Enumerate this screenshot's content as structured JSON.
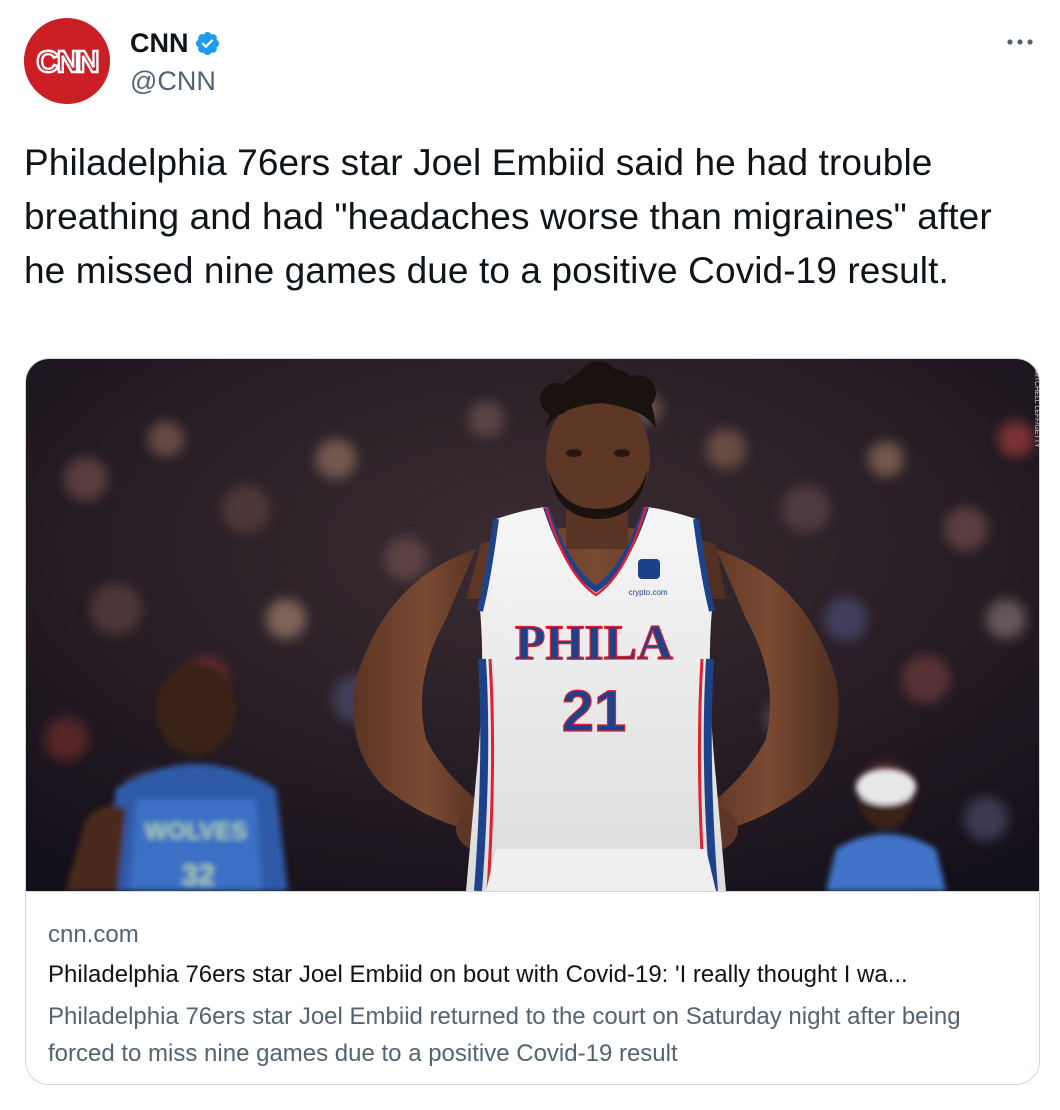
{
  "author": {
    "display_name": "CNN",
    "handle": "@CNN",
    "verified": true,
    "avatar_logo_text": "CNN",
    "avatar_color": "#cc1f25",
    "verified_color": "#1d9bf0"
  },
  "more_menu_icon": "more-horizontal-icon",
  "tweet": {
    "text": "Philadelphia 76ers star Joel Embiid said he had trouble breathing and had \"headaches worse than migraines\" after he missed nine games due to a positive Covid-19 result."
  },
  "card": {
    "image": {
      "jersey_text": "PHILA",
      "jersey_number": "21",
      "sponsor_text": "crypto.com",
      "opponent_jersey_text": "WOLVES",
      "opponent_number": "32",
      "photo_credit": "MITCHELL LEFF/GETTY"
    },
    "domain": "cnn.com",
    "title": "Philadelphia 76ers star Joel Embiid on bout with Covid-19: 'I really thought I wa...",
    "description": "Philadelphia 76ers star Joel Embiid returned to the court on Saturday night after being forced to miss nine games due to a positive Covid-19 result"
  }
}
